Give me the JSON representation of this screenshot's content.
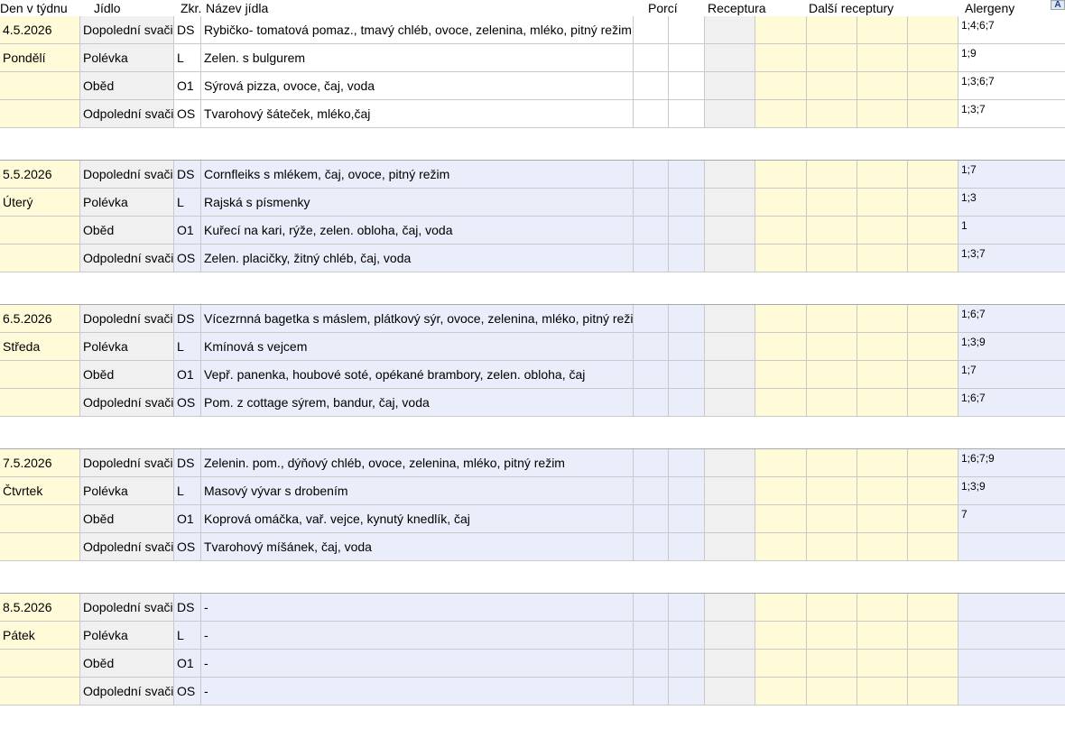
{
  "columns": {
    "den": "Den v týdnu",
    "jidlo": "Jídlo",
    "zkr": "Zkr.",
    "nazev": "Název jídla",
    "porci": "Porcí",
    "receptura": "Receptura",
    "dalsi": "Další receptury",
    "alergeny": "Alergeny",
    "corner": "A"
  },
  "days": [
    {
      "date": "4.5.2026",
      "weekday": "Pondělí",
      "meals": [
        {
          "type": "Dopolední svačina",
          "code": "DS",
          "name": "Rybičko- tomatová pomaz., tmavý chléb,  ovoce, zelenina, mléko, pitný režim",
          "allergens": "1;4;6;7"
        },
        {
          "type": "Polévka",
          "code": "L",
          "name": "Zelen. s bulgurem",
          "allergens": "1;9"
        },
        {
          "type": "Oběd",
          "code": "O1",
          "name": "Sýrová pizza, ovoce, čaj, voda",
          "allergens": "1;3;6;7"
        },
        {
          "type": "Odpolední svačina",
          "code": "OS",
          "name": "Tvarohový šáteček, mléko,čaj",
          "allergens": "1;3;7"
        }
      ]
    },
    {
      "date": "5.5.2026",
      "weekday": "Úterý",
      "meals": [
        {
          "type": "Dopolední svačina",
          "code": "DS",
          "name": "Cornfleiks s mlékem, čaj, ovoce, pitný režim",
          "allergens": "1;7"
        },
        {
          "type": "Polévka",
          "code": "L",
          "name": "Rajská s písmenky",
          "allergens": "1;3"
        },
        {
          "type": "Oběd",
          "code": "O1",
          "name": "Kuřecí na kari, rýže, zelen. obloha, čaj, voda",
          "allergens": "1"
        },
        {
          "type": "Odpolední svačina",
          "code": "OS",
          "name": "Zelen. placičky, žitný chléb, čaj, voda",
          "allergens": "1;3;7"
        }
      ]
    },
    {
      "date": "6.5.2026",
      "weekday": "Středa",
      "meals": [
        {
          "type": "Dopolední svačina",
          "code": "DS",
          "name": "Vícezrnná bagetka s máslem, plátkový sýr,  ovoce, zelenina, mléko, pitný režim",
          "allergens": "1;6;7"
        },
        {
          "type": "Polévka",
          "code": "L",
          "name": "Kmínová s vejcem",
          "allergens": "1;3;9"
        },
        {
          "type": "Oběd",
          "code": "O1",
          "name": "Vepř. panenka, houbové soté, opékané brambory, zelen. obloha, čaj",
          "allergens": "1;7"
        },
        {
          "type": "Odpolední svačina",
          "code": "OS",
          "name": "Pom. z cottage sýrem, bandur, čaj, voda",
          "allergens": "1;6;7"
        }
      ]
    },
    {
      "date": "7.5.2026",
      "weekday": "Čtvrtek",
      "meals": [
        {
          "type": "Dopolední svačina",
          "code": "DS",
          "name": "Zelenin. pom., dýňový chléb,  ovoce, zelenina, mléko, pitný režim",
          "allergens": "1;6;7;9"
        },
        {
          "type": "Polévka",
          "code": "L",
          "name": "Masový vývar s drobením",
          "allergens": "1;3;9"
        },
        {
          "type": "Oběd",
          "code": "O1",
          "name": "Koprová omáčka, vař. vejce, kynutý knedlík, čaj",
          "allergens": "7"
        },
        {
          "type": "Odpolední svačina",
          "code": "OS",
          "name": "Tvarohový míšánek, čaj, voda",
          "allergens": ""
        }
      ]
    },
    {
      "date": "8.5.2026",
      "weekday": "Pátek",
      "meals": [
        {
          "type": "Dopolední svačina",
          "code": "DS",
          "name": "-",
          "allergens": ""
        },
        {
          "type": "Polévka",
          "code": "L",
          "name": "-",
          "allergens": ""
        },
        {
          "type": "Oběd",
          "code": "O1",
          "name": "-",
          "allergens": ""
        },
        {
          "type": "Odpolední svačina",
          "code": "OS",
          "name": "-",
          "allergens": ""
        }
      ]
    }
  ]
}
